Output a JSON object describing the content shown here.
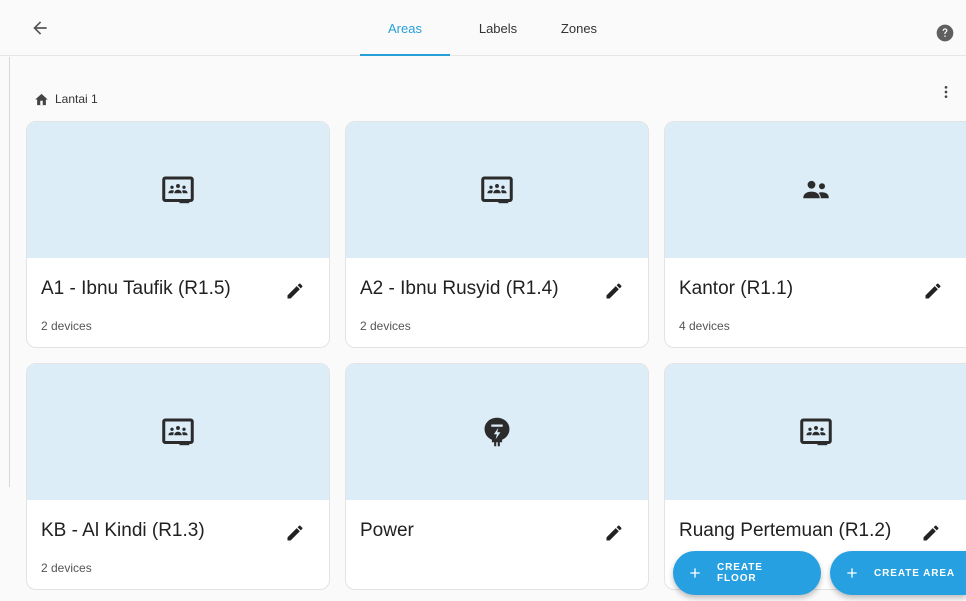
{
  "tabs": [
    {
      "label": "Areas",
      "active": true
    },
    {
      "label": "Labels",
      "active": false
    },
    {
      "label": "Zones",
      "active": false
    }
  ],
  "floor": {
    "name": "Lantai 1",
    "icon": "home-floor-icon"
  },
  "cards": [
    {
      "title": "A1 - Ibnu Taufik (R1.5)",
      "subtitle": "2 devices",
      "icon": "google-classroom-icon"
    },
    {
      "title": "A2 - Ibnu Rusyid (R1.4)",
      "subtitle": "2 devices",
      "icon": "google-classroom-icon"
    },
    {
      "title": "Kantor (R1.1)",
      "subtitle": "4 devices",
      "icon": "account-group-icon"
    },
    {
      "title": "KB - Al Kindi (R1.3)",
      "subtitle": "2 devices",
      "icon": "google-classroom-icon"
    },
    {
      "title": "Power",
      "subtitle": "",
      "icon": "power-plug-badge-icon"
    },
    {
      "title": "Ruang Pertemuan (R1.2)",
      "subtitle": "",
      "icon": "google-classroom-icon"
    }
  ],
  "fabs": {
    "create_floor": "CREATE FLOOR",
    "create_area": "CREATE AREA"
  },
  "colors": {
    "accent": "#26a0d8",
    "card_image_bg": "#dcedf8",
    "fab_bg": "#26a0e0"
  }
}
